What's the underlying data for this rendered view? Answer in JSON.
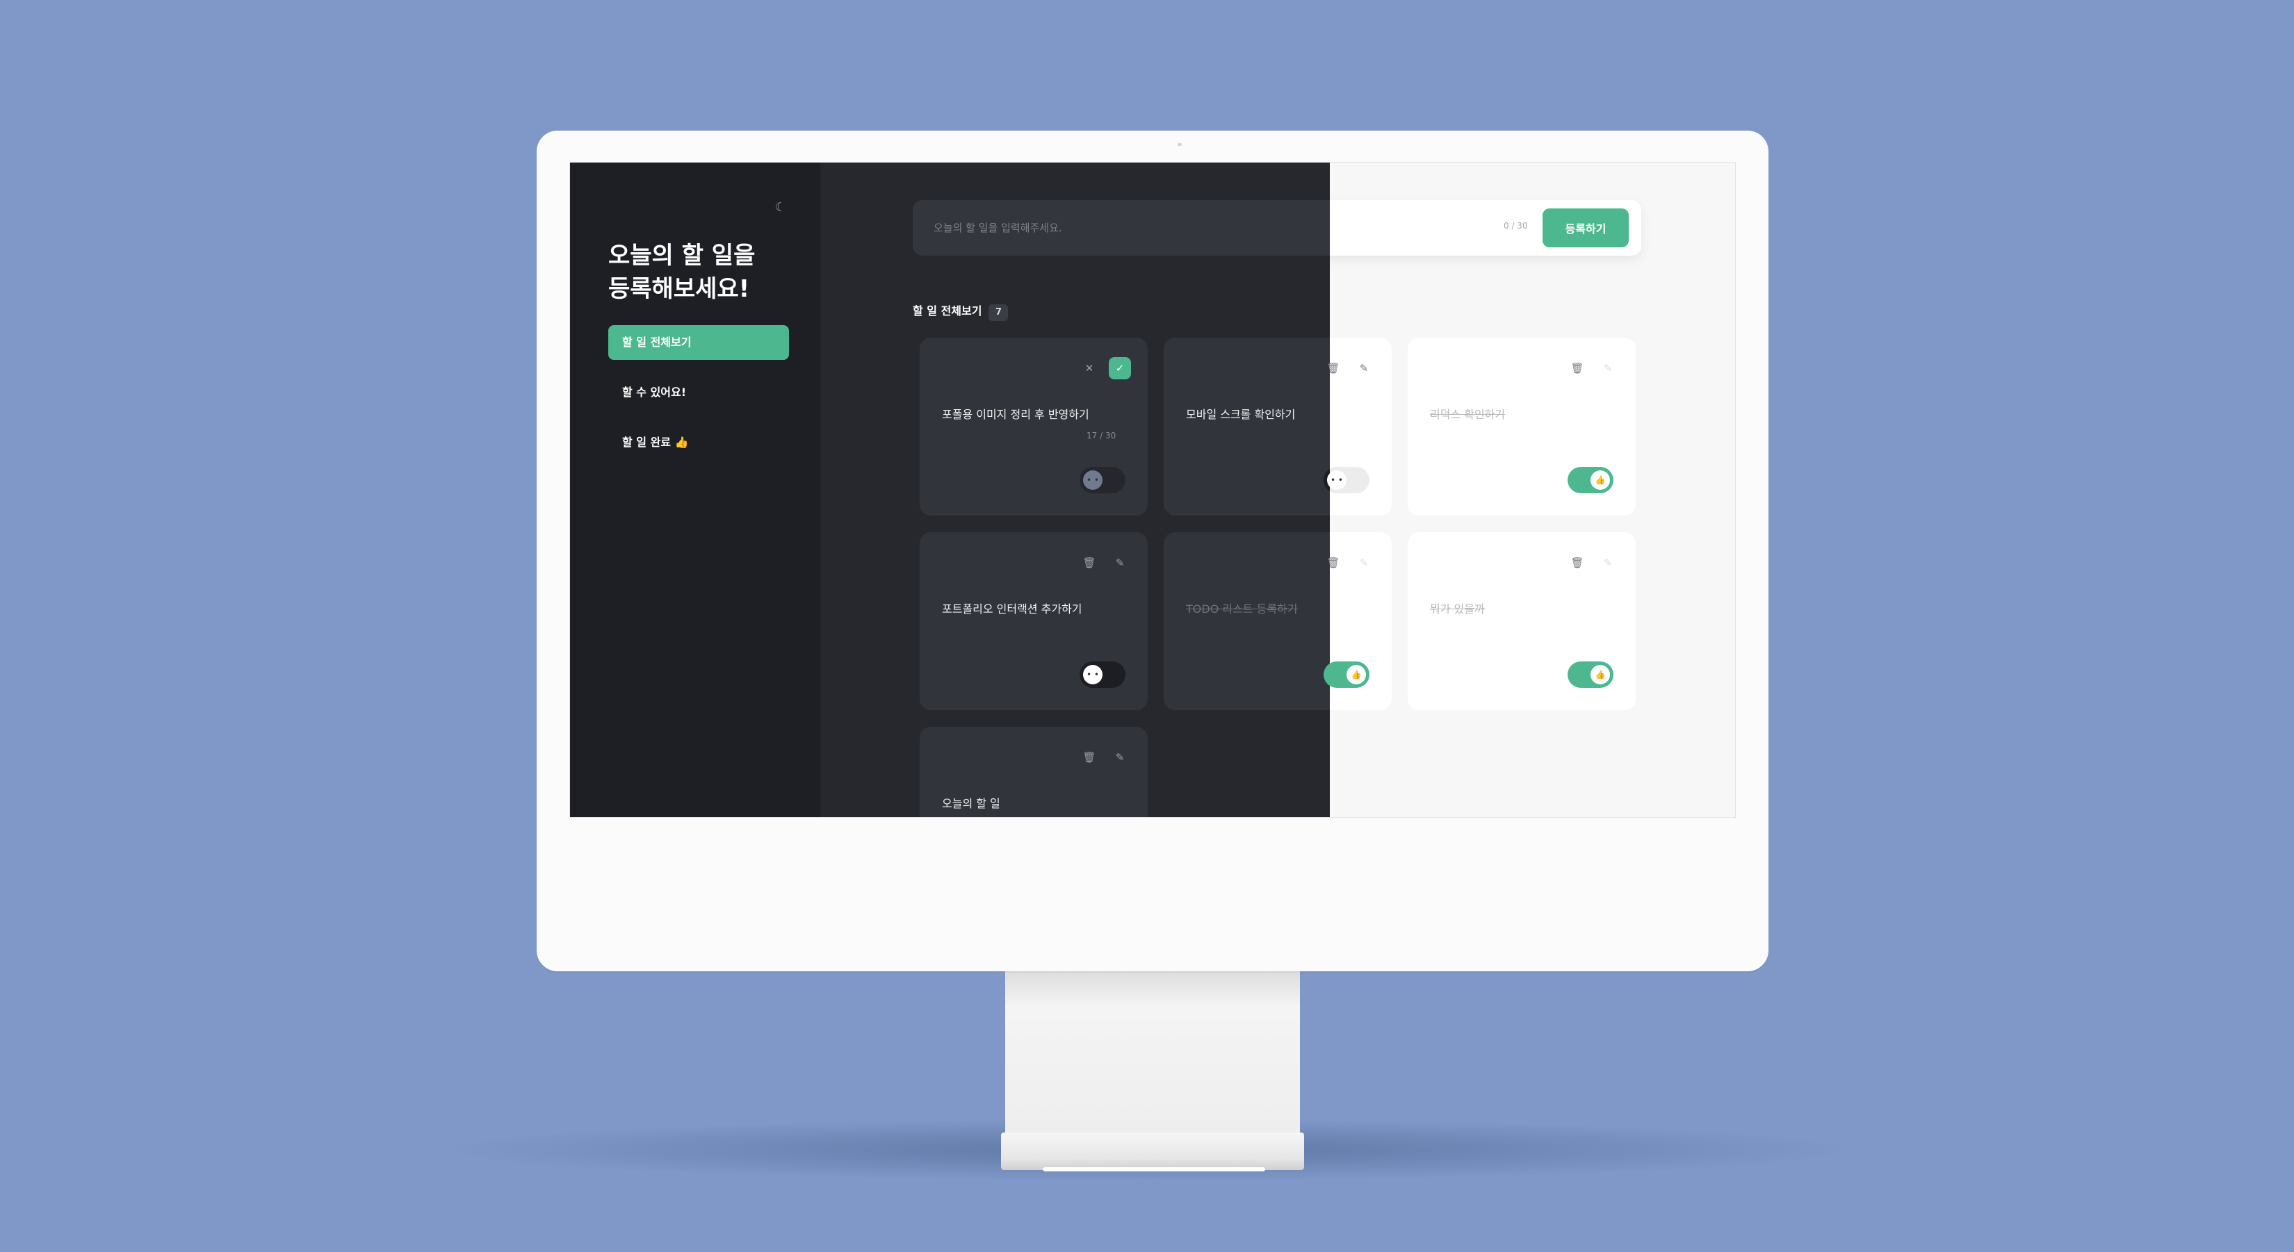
{
  "sidebar": {
    "theme_icon": "☾",
    "headline_line1": "오늘의 할 일을",
    "headline_line2": "등록해보세요!",
    "nav": [
      {
        "label": "할 일 전체보기",
        "active": true
      },
      {
        "label": "할 수 있어요!",
        "active": false
      },
      {
        "label": "할 일 완료 👍",
        "active": false
      }
    ]
  },
  "input": {
    "placeholder": "오늘의 할 일을 입력해주세요.",
    "counter": "0 / 30",
    "submit_label": "등록하기"
  },
  "list": {
    "title": "할 일 전체보기",
    "count": "7"
  },
  "todos": [
    {
      "title": "포폴용 이미지 정리 후 반영하기",
      "done": false,
      "editing": true,
      "edit_counter": "17 / 30",
      "knob": "• •"
    },
    {
      "title": "모바일 스크롤 확인하기",
      "done": false,
      "editing": false,
      "knob": "• •"
    },
    {
      "title": "리덕스 확인하기",
      "done": true,
      "editing": false,
      "knob": "👍"
    },
    {
      "title": "포트폴리오 인터랙션 추가하기",
      "done": false,
      "editing": false,
      "knob": "• •"
    },
    {
      "title": "TODO 리스트 등록하기",
      "done": true,
      "editing": false,
      "knob": "👍"
    },
    {
      "title": "뭐가 있을까",
      "done": true,
      "editing": false,
      "knob": "👍"
    },
    {
      "title": "오늘의 할 일",
      "done": false,
      "editing": false,
      "knob": "• •"
    }
  ],
  "icons": {
    "close": "✕",
    "check": "✓",
    "trash": "🗑",
    "pencil": "✎"
  },
  "colors": {
    "accent": "#4db88f",
    "dark_bg": "#26282e",
    "dark_card": "#31343b",
    "light_bg": "#f7f7f7",
    "backdrop": "#7f98c8"
  }
}
